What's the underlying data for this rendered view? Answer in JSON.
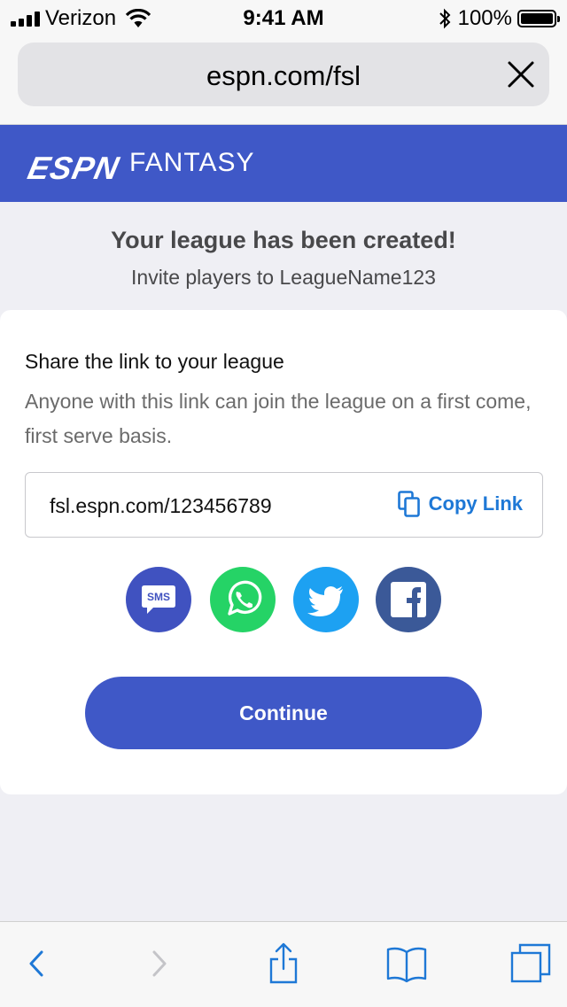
{
  "status_bar": {
    "carrier": "Verizon",
    "time": "9:41 AM",
    "battery": "100%"
  },
  "browser": {
    "url": "espn.com/fsl"
  },
  "header": {
    "logo": "ESPN",
    "product": "FANTASY"
  },
  "headline": {
    "title": "Your league has been created!",
    "subtitle": "Invite players to LeagueName123"
  },
  "share": {
    "title": "Share the link to your league",
    "description": "Anyone with this link can join the league on a first come, first serve basis.",
    "link": "fsl.espn.com/123456789",
    "copy_label": "Copy Link",
    "sms_label": "SMS",
    "social_icons": [
      "sms-icon",
      "whatsapp-icon",
      "twitter-icon",
      "facebook-icon"
    ]
  },
  "actions": {
    "continue_label": "Continue"
  },
  "toolbar": {
    "icons": [
      "back-icon",
      "forward-icon",
      "share-icon",
      "bookmarks-icon",
      "tabs-icon"
    ]
  },
  "colors": {
    "brand": "#3f58c7",
    "link": "#1e78d6",
    "sms": "#4052c0",
    "whatsapp": "#25d366",
    "twitter": "#1da1f2",
    "facebook": "#3b5998"
  }
}
